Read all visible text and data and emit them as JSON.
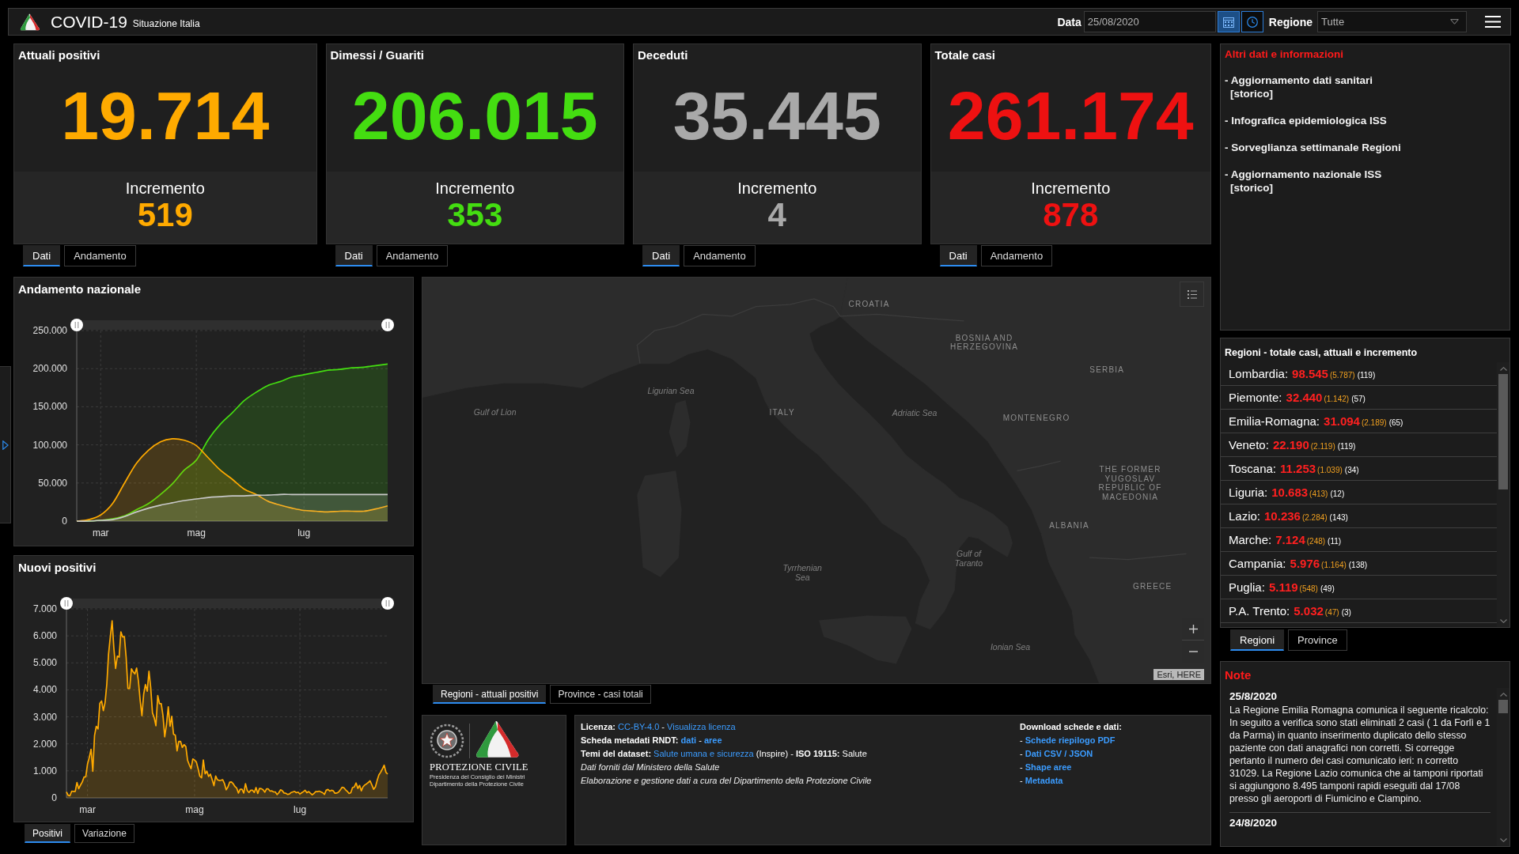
{
  "header": {
    "title": "COVID-19",
    "subtitle": "Situazione Italia",
    "date_label": "Data",
    "date_value": "25/08/2020",
    "region_label": "Regione",
    "region_value": "Tutte"
  },
  "cards": [
    {
      "title": "Attuali positivi",
      "value": "19.714",
      "increment_label": "Incremento",
      "increment": "519",
      "color": "#ffaa00",
      "tabs": [
        {
          "label": "Dati",
          "selected": true
        },
        {
          "label": "Andamento",
          "selected": false
        }
      ]
    },
    {
      "title": "Dimessi / Guariti",
      "value": "206.015",
      "increment_label": "Incremento",
      "increment": "353",
      "color": "#44dd11",
      "tabs": [
        {
          "label": "Dati",
          "selected": true
        },
        {
          "label": "Andamento",
          "selected": false
        }
      ]
    },
    {
      "title": "Deceduti",
      "value": "35.445",
      "increment_label": "Incremento",
      "increment": "4",
      "color": "#a9a9a9",
      "tabs": [
        {
          "label": "Dati",
          "selected": true
        },
        {
          "label": "Andamento",
          "selected": false
        }
      ]
    },
    {
      "title": "Totale casi",
      "value": "261.174",
      "increment_label": "Incremento",
      "increment": "878",
      "color": "#ee1111",
      "tabs": [
        {
          "label": "Dati",
          "selected": true
        },
        {
          "label": "Andamento",
          "selected": false
        }
      ]
    }
  ],
  "trend_chart": {
    "title": "Andamento nazionale",
    "chart_data": {
      "type": "area",
      "grid": true,
      "categories": [
        null,
        null,
        "mar",
        null,
        null,
        null,
        null,
        null,
        null,
        null,
        "mag",
        null,
        null,
        null,
        null,
        null,
        null,
        null,
        null,
        "lug",
        null,
        null,
        null,
        null,
        null,
        null,
        null
      ],
      "ylim": [
        0,
        250
      ],
      "yticks": [
        {
          "value": 0,
          "label": "0"
        },
        {
          "value": 50,
          "label": "50.000"
        },
        {
          "value": 100,
          "label": "100.000"
        },
        {
          "value": 150,
          "label": "150.000"
        },
        {
          "value": 200,
          "label": "200.000"
        },
        {
          "value": 250,
          "label": "250.000"
        }
      ],
      "series": [
        {
          "color": "#44dd11",
          "values": [
            0,
            0,
            1,
            3,
            7,
            15,
            23,
            35,
            49,
            67,
            80,
            107,
            127,
            142,
            158,
            169,
            178,
            183,
            189,
            192,
            195,
            198,
            199,
            201,
            202,
            204,
            206
          ]
        },
        {
          "color": "#ffaa00",
          "values": [
            0,
            2,
            8,
            23,
            50,
            76,
            93,
            104,
            108,
            106,
            99,
            83,
            67,
            55,
            42,
            35,
            26,
            21,
            17,
            14,
            13,
            12,
            13,
            13,
            13,
            16,
            20
          ]
        },
        {
          "color": "#c8c8c8",
          "values": [
            0,
            0,
            1,
            2,
            6,
            12,
            17,
            21,
            24,
            27,
            29,
            31,
            32,
            33,
            33,
            34,
            34,
            35,
            35,
            35,
            35,
            35,
            35,
            35,
            35,
            35,
            35
          ]
        }
      ]
    }
  },
  "new_cases_chart": {
    "title": "Nuovi positivi",
    "chart_data": {
      "type": "area",
      "grid": true,
      "categories": [
        null,
        null,
        null,
        null,
        null,
        null,
        null,
        null,
        null,
        null,
        null,
        null,
        "mar",
        null,
        null,
        null,
        null,
        null,
        null,
        null,
        null,
        null,
        null,
        null,
        null,
        null,
        null,
        null,
        null,
        null,
        null,
        null,
        null,
        null,
        null,
        null,
        null,
        null,
        null,
        null,
        null,
        null,
        null,
        null,
        null,
        null,
        null,
        null,
        null,
        null,
        null,
        null,
        null,
        null,
        null,
        null,
        null,
        null,
        null,
        null,
        null,
        null,
        null,
        null,
        null,
        null,
        null,
        null,
        null,
        null,
        null,
        null,
        null,
        "mag",
        null,
        null,
        null,
        null,
        null,
        null,
        null,
        null,
        null,
        null,
        null,
        null,
        null,
        null,
        null,
        null,
        null,
        null,
        null,
        null,
        null,
        null,
        null,
        null,
        null,
        null,
        null,
        null,
        null,
        null,
        null,
        null,
        null,
        null,
        null,
        null,
        null,
        null,
        null,
        null,
        null,
        null,
        null,
        null,
        null,
        null,
        null,
        null,
        null,
        null,
        null,
        null,
        null,
        null,
        null,
        null,
        null,
        null,
        null,
        "lug",
        null,
        null,
        null,
        null,
        null,
        null,
        null,
        null,
        null,
        null,
        null,
        null,
        null,
        null,
        null,
        null,
        null,
        null,
        null,
        null,
        null,
        null,
        null,
        null,
        null,
        null,
        null,
        null,
        null,
        null,
        null,
        null,
        null,
        null,
        null,
        null,
        null,
        null,
        null,
        null,
        null,
        null,
        null,
        null,
        null,
        null,
        null,
        null,
        null,
        null
      ],
      "ylim": [
        0,
        7
      ],
      "yticks": [
        {
          "value": 0,
          "label": "0"
        },
        {
          "value": 1,
          "label": "1.000"
        },
        {
          "value": 2,
          "label": "2.000"
        },
        {
          "value": 3,
          "label": "3.000"
        },
        {
          "value": 4,
          "label": "4.000"
        },
        {
          "value": 5,
          "label": "5.000"
        },
        {
          "value": 6,
          "label": "6.000"
        },
        {
          "value": 7,
          "label": "7.000"
        }
      ],
      "series": [
        {
          "color": "#ffaa00",
          "values": [
            0.22,
            0.09,
            0.08,
            0.25,
            0.24,
            0.24,
            0.57,
            0.34,
            0.47,
            0.59,
            0.77,
            0.78,
            1.25,
            1.49,
            1.8,
            0.98,
            2.31,
            2.65,
            2.55,
            3.5,
            3.59,
            3.23,
            3.53,
            4.21,
            5.32,
            5.99,
            6.56,
            5.56,
            4.79,
            5.25,
            5.21,
            6.15,
            5.96,
            5.97,
            5.22,
            4.05,
            4.05,
            4.78,
            4.67,
            4.59,
            4.81,
            4.32,
            3.6,
            3.04,
            3.84,
            4.2,
            3.95,
            4.69,
            4.09,
            3.15,
            2.97,
            2.67,
            3.79,
            3.49,
            3.49,
            3.05,
            2.26,
            2.73,
            3.37,
            2.65,
            3.02,
            2.36,
            2.32,
            1.74,
            2.09,
            2.09,
            1.87,
            1.97,
            1.9,
            1.39,
            1.22,
            1.08,
            1.44,
            1.4,
            1.33,
            1.08,
            0.8,
            0.74,
            1.4,
            0.89,
            0.99,
            0.79,
            0.88,
            0.68,
            0.45,
            0.81,
            0.67,
            0.64,
            0.65,
            0.67,
            0.53,
            0.3,
            0.4,
            0.58,
            0.59,
            0.52,
            0.42,
            0.36,
            0.18,
            0.32,
            0.32,
            0.18,
            0.52,
            0.27,
            0.2,
            0.28,
            0.28,
            0.2,
            0.38,
            0.16,
            0.35,
            0.34,
            0.3,
            0.21,
            0.33,
            0.33,
            0.25,
            0.26,
            0.22,
            0.22,
            0.12,
            0.19,
            0.3,
            0.26,
            0.18,
            0.17,
            0.13,
            0.14,
            0.2,
            0.22,
            0.24,
            0.19,
            0.21,
            0.14,
            0.19,
            0.23,
            0.28,
            0.19,
            0.23,
            0.17,
            0.11,
            0.16,
            0.23,
            0.23,
            0.25,
            0.22,
            0.19,
            0.13,
            0.28,
            0.31,
            0.25,
            0.28,
            0.26,
            0.17,
            0.18,
            0.21,
            0.29,
            0.39,
            0.38,
            0.3,
            0.24,
            0.16,
            0.19,
            0.38,
            0.4,
            0.55,
            0.35,
            0.46,
            0.26,
            0.41,
            0.48,
            0.52,
            0.57,
            0.63,
            0.48,
            0.32,
            0.4,
            0.64,
            0.85,
            0.95,
            1.07,
            1.21,
            0.95,
            0.88
          ]
        }
      ]
    },
    "tabs": [
      {
        "label": "Positivi",
        "selected": true
      },
      {
        "label": "Variazione",
        "selected": false
      }
    ]
  },
  "map": {
    "labels": [
      {
        "text": "CROATIA",
        "kind": "country"
      },
      {
        "text": "BOSNIA AND\nHERZEGOVINA",
        "kind": "country"
      },
      {
        "text": "SERBIA",
        "kind": "country"
      },
      {
        "text": "Ligurian Sea",
        "kind": "sea"
      },
      {
        "text": "Gulf of Lion",
        "kind": "sea"
      },
      {
        "text": "ITALY",
        "kind": "country"
      },
      {
        "text": "Adriatic Sea",
        "kind": "sea"
      },
      {
        "text": "MONTENEGRO",
        "kind": "country"
      },
      {
        "text": "THE FORMER YUGOSLAV\nREPUBLIC OF\nMACEDONIA",
        "kind": "country"
      },
      {
        "text": "ALBANIA",
        "kind": "country"
      },
      {
        "text": "Gulf of\nTaranto",
        "kind": "sea"
      },
      {
        "text": "Tyrrhenian\nSea",
        "kind": "sea"
      },
      {
        "text": "GREECE",
        "kind": "country"
      },
      {
        "text": "Ionian Sea",
        "kind": "sea"
      }
    ],
    "attribution": "Esri, HERE",
    "tabs": [
      {
        "label": "Regioni - attuali positivi",
        "selected": true
      },
      {
        "label": "Province - casi totali",
        "selected": false
      }
    ]
  },
  "logo_panel": {
    "name": "PROTEZIONE CIVILE",
    "lines": [
      "Presidenza del Consiglio dei Ministri",
      "Dipartimento della Protezione Civile"
    ]
  },
  "info": {
    "lines": [
      {
        "segments": [
          {
            "kind": "label",
            "text": "Licenza:"
          },
          {
            "kind": "link",
            "text": "CC-BY-4.0"
          },
          {
            "kind": "text",
            "text": "-"
          },
          {
            "kind": "link",
            "text": "Visualizza licenza"
          }
        ]
      },
      {
        "segments": [
          {
            "kind": "label",
            "text": "Scheda metadati RNDT:"
          },
          {
            "kind": "strong_link",
            "text": "dati"
          },
          {
            "kind": "text",
            "text": "-"
          },
          {
            "kind": "strong_link",
            "text": "aree"
          }
        ]
      },
      {
        "segments": [
          {
            "kind": "label",
            "text": "Temi del dataset:"
          },
          {
            "kind": "link",
            "text": "Salute umana e sicurezza"
          },
          {
            "kind": "text",
            "text": "(Inspire) -"
          },
          {
            "kind": "label",
            "text": "ISO 19115:"
          },
          {
            "kind": "text",
            "text": "Salute"
          }
        ]
      },
      {
        "segments": [
          {
            "kind": "note",
            "text": "Dati forniti dal Ministero della Salute"
          }
        ]
      },
      {
        "segments": [
          {
            "kind": "note",
            "text": "Elaborazione e gestione dati a cura del Dipartimento della Protezione Civile"
          }
        ]
      }
    ],
    "download_title": "Download schede e dati:",
    "downloads": [
      {
        "bullet": "-",
        "text": "Schede riepilogo PDF"
      },
      {
        "bullet": "-",
        "text": "Dati CSV / JSON"
      },
      {
        "bullet": "-",
        "text": "Shape aree"
      },
      {
        "bullet": "-",
        "text": "Metadata"
      }
    ]
  },
  "info_panel": {
    "title": "Altri dati e informazioni",
    "links": [
      {
        "text": "- Aggiornamento dati sanitari",
        "sub": "[storico]"
      },
      {
        "text": "- Infografica epidemiologica ISS"
      },
      {
        "text": "- Sorveglianza settimanale Regioni"
      },
      {
        "text": "- Aggiornamento nazionale ISS",
        "sub": "[storico]"
      }
    ]
  },
  "regions": {
    "title": "Regioni - totale casi, attuali e incremento",
    "rows": [
      {
        "name": "Lombardia:",
        "total": "98.545",
        "current": "(5.787)",
        "increment": "(119)"
      },
      {
        "name": "Piemonte:",
        "total": "32.440",
        "current": "(1.142)",
        "increment": "(57)"
      },
      {
        "name": "Emilia-Romagna:",
        "total": "31.094",
        "current": "(2.189)",
        "increment": "(65)"
      },
      {
        "name": "Veneto:",
        "total": "22.190",
        "current": "(2.119)",
        "increment": "(119)"
      },
      {
        "name": "Toscana:",
        "total": "11.253",
        "current": "(1.039)",
        "increment": "(34)"
      },
      {
        "name": "Liguria:",
        "total": "10.683",
        "current": "(413)",
        "increment": "(12)"
      },
      {
        "name": "Lazio:",
        "total": "10.236",
        "current": "(2.284)",
        "increment": "(143)"
      },
      {
        "name": "Marche:",
        "total": "7.124",
        "current": "(248)",
        "increment": "(11)"
      },
      {
        "name": "Campania:",
        "total": "5.976",
        "current": "(1.164)",
        "increment": "(138)"
      },
      {
        "name": "Puglia:",
        "total": "5.119",
        "current": "(548)",
        "increment": "(49)"
      },
      {
        "name": "P.A. Trento:",
        "total": "5.032",
        "current": "(47)",
        "increment": "(3)"
      }
    ],
    "tabs": [
      {
        "label": "Regioni",
        "selected": true
      },
      {
        "label": "Province",
        "selected": false
      }
    ]
  },
  "notes": {
    "title": "Note",
    "entries": [
      {
        "date": "25/8/2020",
        "text": "La Regione Emilia Romagna comunica il seguente ricalcolo: In seguito a verifica sono stati eliminati 2 casi ( 1 da Forlì e 1 da Parma) in quanto inserimento duplicato dello stesso paziente con dati anagrafici non corretti. Si corregge pertanto il numero dei casi comunicato ieri: n corretto 31029. La Regione Lazio comunica che ai tamponi riportati si aggiungono 8.495 tamponi rapidi eseguiti dal 17/08 presso gli aeroporti di Fiumicino e Ciampino."
      },
      {
        "date": "24/8/2020"
      }
    ]
  }
}
